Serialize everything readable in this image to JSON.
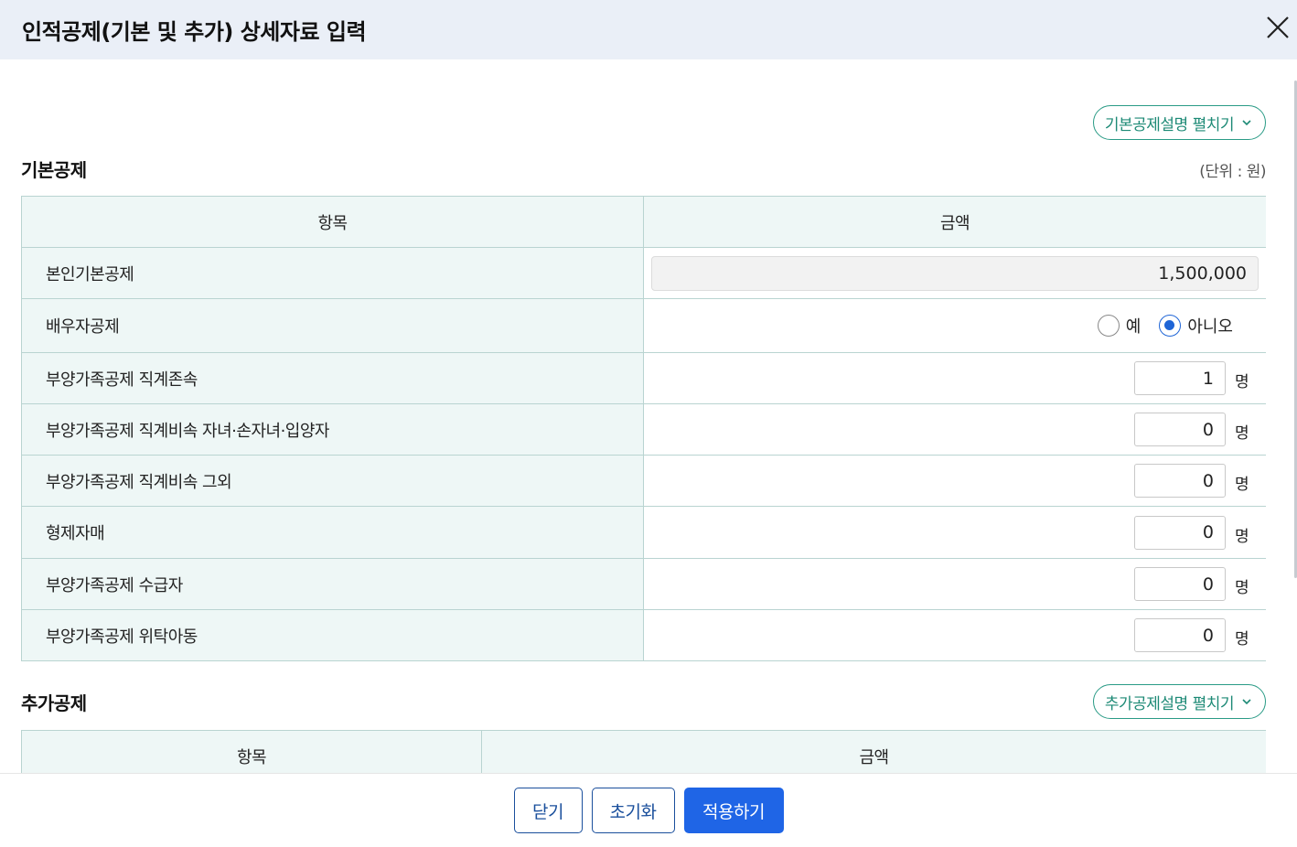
{
  "header": {
    "title": "인적공제(기본 및 추가) 상세자료 입력"
  },
  "basic": {
    "expand_label": "기본공제설명 펼치기",
    "title": "기본공제",
    "unit": "(단위 : 원)",
    "col_item": "항목",
    "col_amount": "금액",
    "self": {
      "label": "본인기본공제",
      "amount": "1,500,000"
    },
    "spouse": {
      "label": "배우자공제",
      "yes_label": "예",
      "no_label": "아니오",
      "selected": "아니오"
    },
    "rows": [
      {
        "label": "부양가족공제 직계존속",
        "count": "1",
        "unit": "명"
      },
      {
        "label": "부양가족공제 직계비속 자녀·손자녀·입양자",
        "count": "0",
        "unit": "명"
      },
      {
        "label": "부양가족공제 직계비속 그외",
        "count": "0",
        "unit": "명"
      },
      {
        "label": "형제자매",
        "count": "0",
        "unit": "명"
      },
      {
        "label": "부양가족공제 수급자",
        "count": "0",
        "unit": "명"
      },
      {
        "label": "부양가족공제 위탁아동",
        "count": "0",
        "unit": "명"
      }
    ]
  },
  "additional": {
    "title": "추가공제",
    "expand_label": "추가공제설명 펼치기",
    "col_item": "항목",
    "col_amount": "금액"
  },
  "footer": {
    "close_label": "닫기",
    "reset_label": "초기화",
    "apply_label": "적용하기"
  },
  "colors": {
    "accent": "#1f65e6",
    "teal": "#2a9b86",
    "header_bg": "#eaeff7",
    "cell_bg": "#eef7f6"
  }
}
